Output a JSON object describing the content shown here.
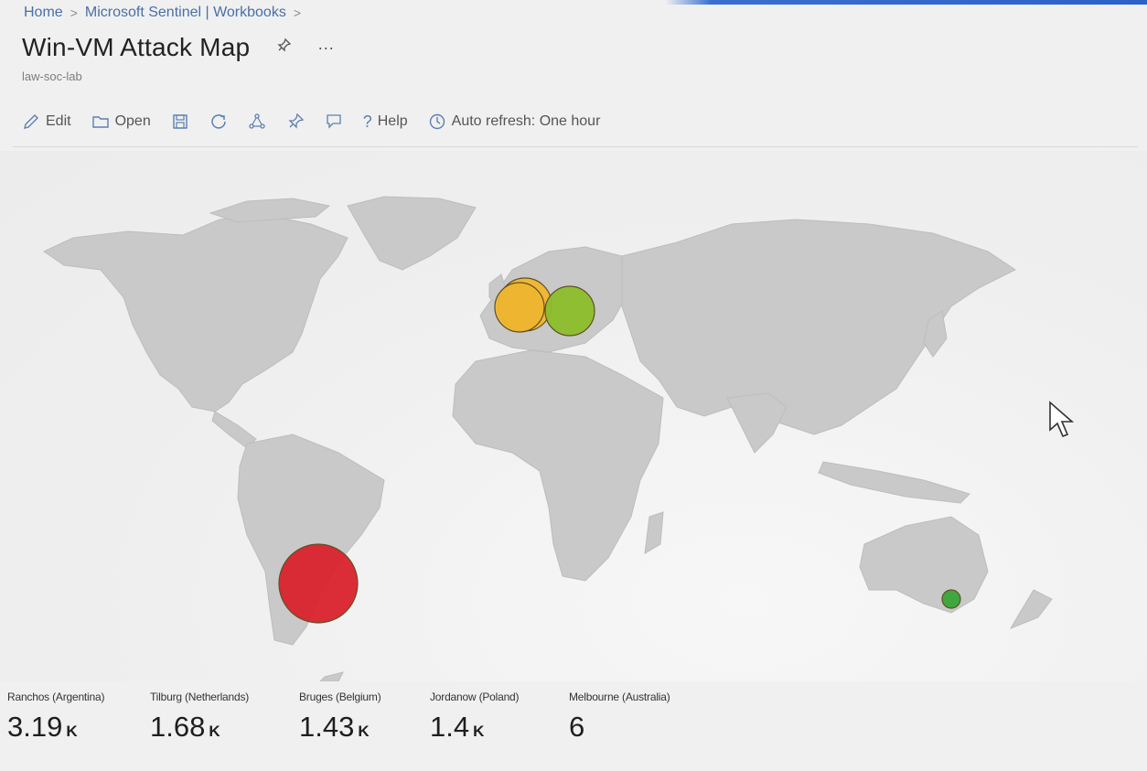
{
  "breadcrumb": {
    "home": "Home",
    "sentinel": "Microsoft Sentinel | Workbooks"
  },
  "page": {
    "title": "Win-VM Attack Map",
    "subtitle": "law-soc-lab",
    "more_label": "···"
  },
  "toolbar": {
    "edit": "Edit",
    "open": "Open",
    "help_glyph": "?",
    "help": "Help",
    "auto_refresh": "Auto refresh: One hour"
  },
  "colors": {
    "red": "#d9232e",
    "orange": "#f0b72f",
    "yellow_green": "#8cbe2c",
    "green": "#3aa537"
  },
  "locations": [
    {
      "label": "Ranchos (Argentina)",
      "value": "3.19",
      "unit": "K",
      "color": "#d9232e"
    },
    {
      "label": "Tilburg (Netherlands)",
      "value": "1.68",
      "unit": "K",
      "color": "#f0b72f"
    },
    {
      "label": "Bruges (Belgium)",
      "value": "1.43",
      "unit": "K",
      "color": "#f0b72f"
    },
    {
      "label": "Jordanow (Poland)",
      "value": "1.4",
      "unit": "K",
      "color": "#8cbe2c"
    },
    {
      "label": "Melbourne (Australia)",
      "value": "6",
      "unit": "",
      "color": "#3aa537"
    }
  ]
}
